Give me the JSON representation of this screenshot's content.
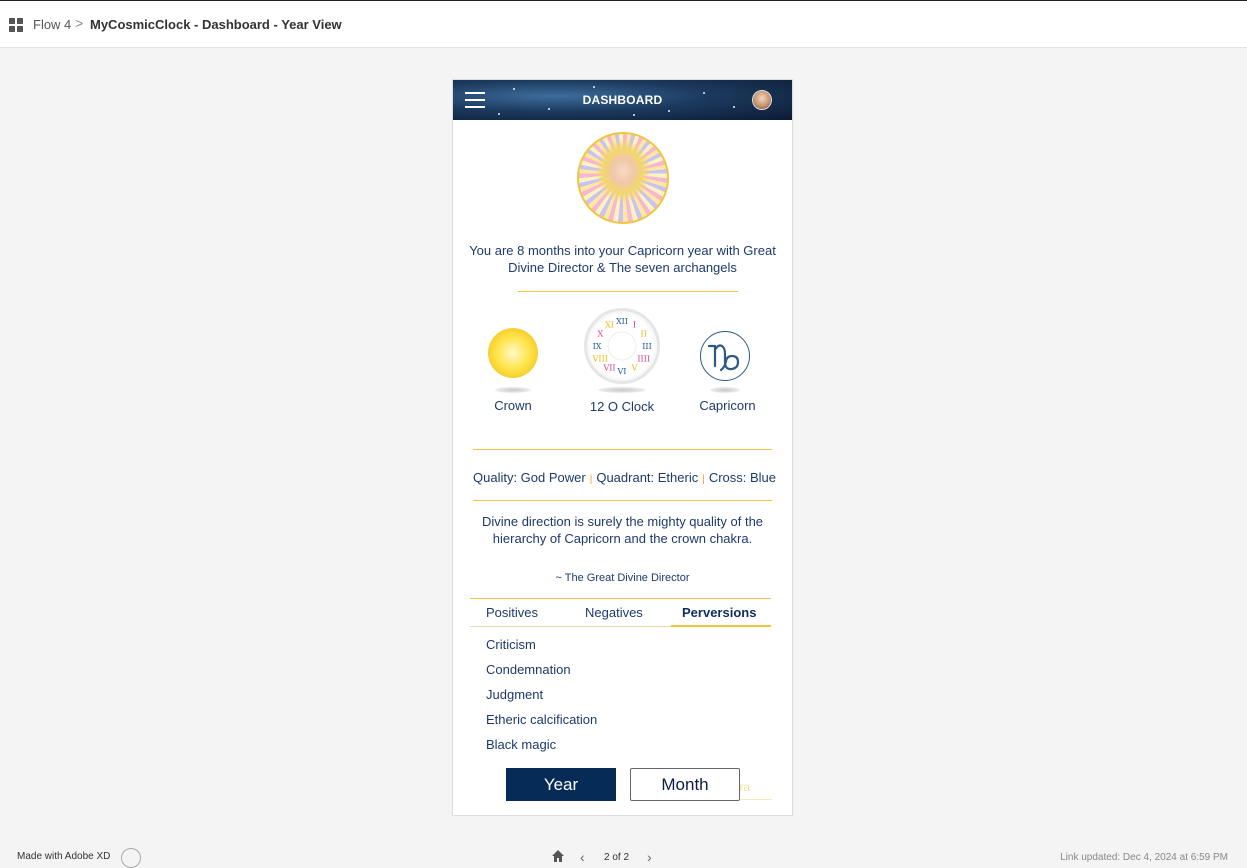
{
  "topbar": {
    "flow_label": "Flow 4",
    "separator": ">",
    "title": "MyCosmicClock - Dashboard - Year View"
  },
  "app": {
    "header_title": "DASHBOARD",
    "intro_text": "You are 8 months into your Capricorn year with Great Divine Director & The seven archangels",
    "orbs": [
      {
        "label": "Crown",
        "icon": "crown-chakra-orb"
      },
      {
        "label": "12 O Clock",
        "icon": "cosmic-clock-icon"
      },
      {
        "label": "Capricorn",
        "icon": "capricorn-sign-icon"
      }
    ],
    "clock_numerals": [
      "XII",
      "I",
      "II",
      "III",
      "IIII",
      "V",
      "VI",
      "VII",
      "VIII",
      "IX",
      "X",
      "XI"
    ],
    "clock_numeral_colors": [
      "#1e5aa8",
      "#d63a8a",
      "#f0b400",
      "#1e5aa8",
      "#d63a8a",
      "#f0b400",
      "#1e5aa8",
      "#d63a8a",
      "#f0b400",
      "#1e5aa8",
      "#d63a8a",
      "#f0b400"
    ],
    "quality": {
      "quality": "Quality: God Power",
      "quadrant": "Quadrant: Etheric",
      "cross": "Cross: Blue",
      "separator": "|"
    },
    "quote": "Divine direction is surely the mighty quality of the hierarchy of Capricorn and the crown chakra.",
    "quote_author": "~ The Great Divine Director",
    "tabs": [
      {
        "label": "Positives",
        "active": false
      },
      {
        "label": "Negatives",
        "active": false
      },
      {
        "label": "Perversions",
        "active": true
      }
    ],
    "perversions": [
      "Criticism",
      "Condemnation",
      "Judgment",
      "Etheric calcification",
      "Black magic"
    ],
    "ghost_text": "tra",
    "year_button": "Year",
    "month_button": "Month"
  },
  "footer": {
    "made_with": "Made with Adobe XD",
    "page_indicator": "2 of 2",
    "link_updated": "Link updated: Dec 4, 2024 at 6:59 PM"
  },
  "colors": {
    "navy": "#072b57",
    "text": "#1d3a6b",
    "gold": "#f0c640",
    "background": "#f4f4f4"
  }
}
